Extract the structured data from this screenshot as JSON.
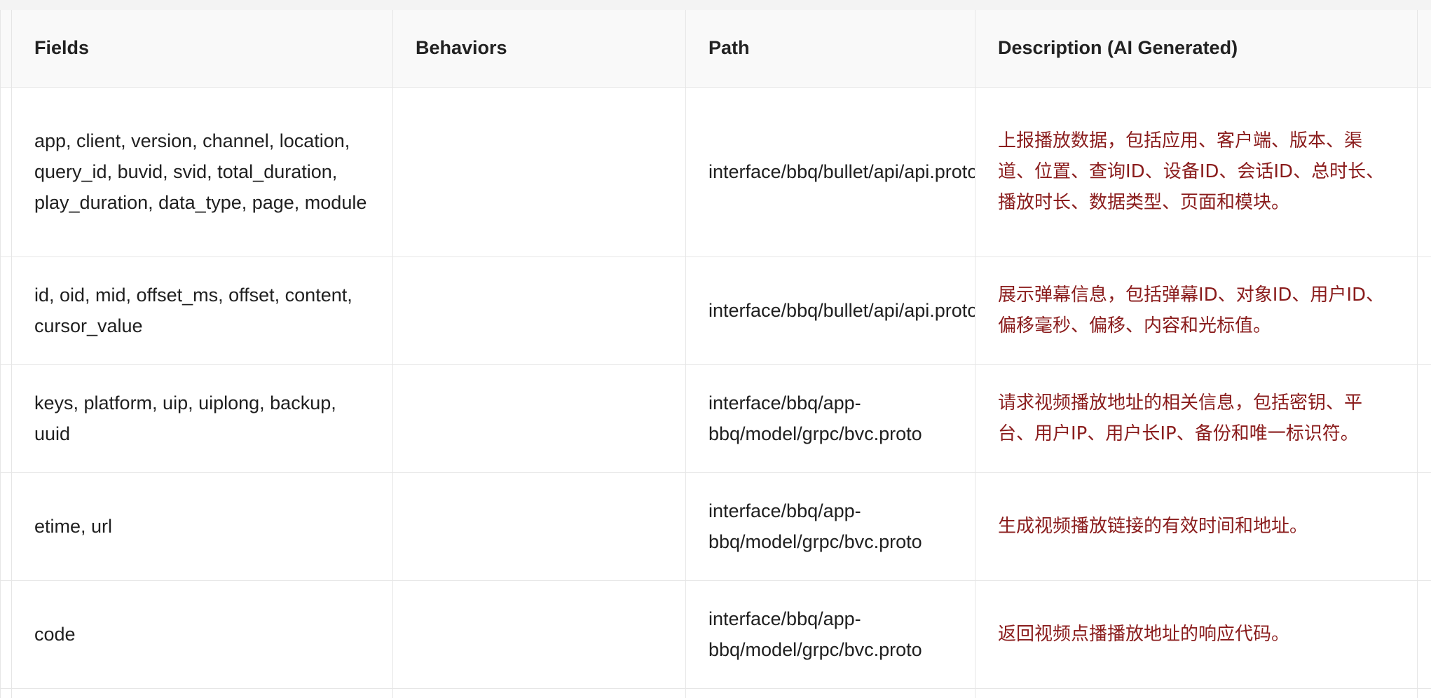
{
  "table": {
    "headers": {
      "fields": "Fields",
      "behaviors": "Behaviors",
      "path": "Path",
      "description": "Description (AI Generated)"
    },
    "rows": [
      {
        "fields": "app, client, version, channel, location, query_id, buvid, svid, total_duration, play_duration, data_type, page, module",
        "behaviors": "",
        "path": "interface/bbq/bullet/api/api.proto",
        "description": "上报播放数据，包括应用、客户端、版本、渠道、位置、查询ID、设备ID、会话ID、总时长、播放时长、数据类型、页面和模块。"
      },
      {
        "fields": "id, oid, mid, offset_ms, offset, content, cursor_value",
        "behaviors": "",
        "path": "interface/bbq/bullet/api/api.proto",
        "description": "展示弹幕信息，包括弹幕ID、对象ID、用户ID、偏移毫秒、偏移、内容和光标值。"
      },
      {
        "fields": "keys, platform, uip, uiplong, backup, uuid",
        "behaviors": "",
        "path": "interface/bbq/app-bbq/model/grpc/bvc.proto",
        "description": "请求视频播放地址的相关信息，包括密钥、平台、用户IP、用户长IP、备份和唯一标识符。"
      },
      {
        "fields": "etime, url",
        "behaviors": "",
        "path": "interface/bbq/app-bbq/model/grpc/bvc.proto",
        "description": "生成视频播放链接的有效时间和地址。"
      },
      {
        "fields": "code",
        "behaviors": "",
        "path": "interface/bbq/app-bbq/model/grpc/bvc.proto",
        "description": "返回视频点播播放地址的响应代码。"
      }
    ]
  },
  "colors": {
    "description_text": "#8a1c1c",
    "header_bg": "#f9f9f9",
    "border": "#e6e6e6"
  }
}
